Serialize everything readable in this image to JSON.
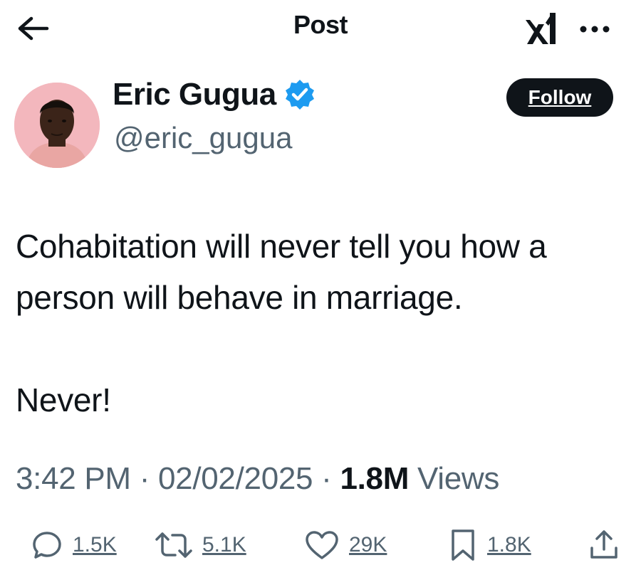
{
  "header": {
    "title": "Post",
    "back_icon": "arrow-left-icon",
    "brand_icon": "xai-logo-icon",
    "more_icon": "more-horizontal-icon"
  },
  "author": {
    "name": "Eric Gugua",
    "handle": "@eric_gugua",
    "verified": true,
    "verified_color": "#1d9bf0",
    "avatar_bg": "#f3b7bd",
    "follow_label": "Follow"
  },
  "post": {
    "text": "Cohabitation will never tell you how a\nperson will behave in marriage.\n\nNever!",
    "time": "3:42 PM",
    "date": "02/02/2025",
    "views_count": "1.8M",
    "views_label": "Views",
    "separator": "·"
  },
  "actions": {
    "replies": "1.5K",
    "reposts": "5.1K",
    "likes": "29K",
    "bookmarks": "1.8K"
  },
  "colors": {
    "text_primary": "#0f1419",
    "text_secondary": "#536471",
    "button_dark": "#0f1419"
  }
}
